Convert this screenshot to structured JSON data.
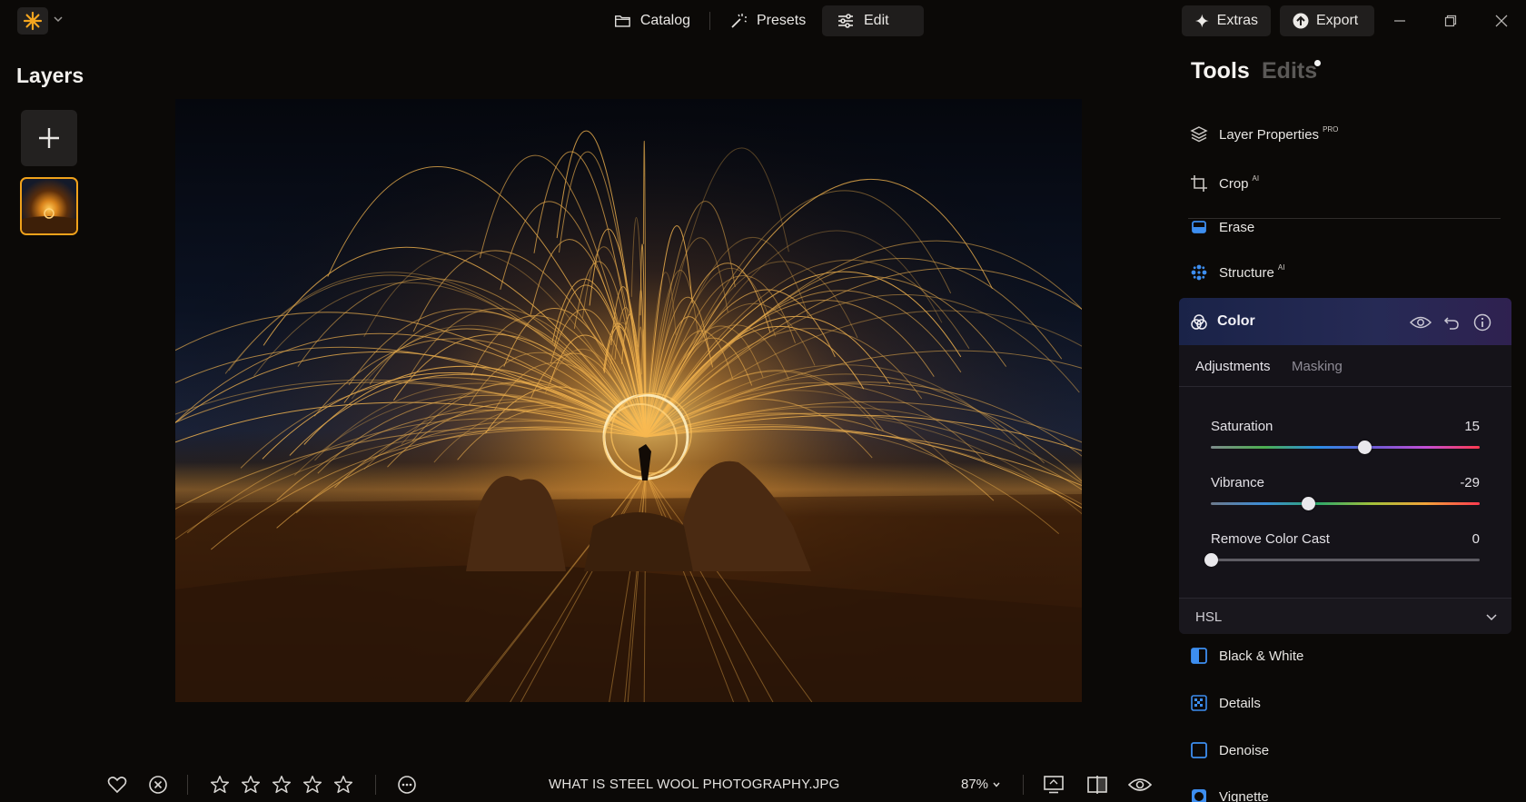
{
  "app": {
    "logo_icon": "sparkle-icon",
    "accent_color": "#f0a21b"
  },
  "nav": {
    "catalog": "Catalog",
    "presets": "Presets",
    "edit": "Edit",
    "active": "edit"
  },
  "top_buttons": {
    "extras": "Extras",
    "export": "Export"
  },
  "layers": {
    "title": "Layers"
  },
  "panel": {
    "tab_tools": "Tools",
    "tab_edits": "Edits",
    "active_tab": "tools",
    "tools": [
      {
        "label": "Layer Properties",
        "badge": "PRO",
        "icon": "layers-icon"
      },
      {
        "label": "Crop",
        "badge": "AI",
        "icon": "crop-icon"
      },
      {
        "label": "Erase",
        "badge": "",
        "icon": "erase-icon"
      },
      {
        "label": "Structure",
        "badge": "AI",
        "icon": "structure-icon"
      },
      {
        "label": "Black & White",
        "badge": "",
        "icon": "black-white-icon"
      },
      {
        "label": "Details",
        "badge": "",
        "icon": "details-icon"
      },
      {
        "label": "Denoise",
        "badge": "",
        "icon": "denoise-icon"
      },
      {
        "label": "Vignette",
        "badge": "",
        "icon": "vignette-icon"
      }
    ],
    "color": {
      "title": "Color",
      "subtabs": [
        "Adjustments",
        "Masking"
      ],
      "active_subtab": "Adjustments",
      "sliders": [
        {
          "label": "Saturation",
          "value": "15",
          "fraction": 0.57
        },
        {
          "label": "Vibrance",
          "value": "-29",
          "fraction": 0.36
        },
        {
          "label": "Remove Color Cast",
          "value": "0",
          "fraction": 0.0
        }
      ],
      "hsl": "HSL"
    }
  },
  "bottom": {
    "filename": "WHAT IS STEEL WOOL PHOTOGRAPHY.JPG",
    "zoom": "87%",
    "rating_stars": 5
  }
}
